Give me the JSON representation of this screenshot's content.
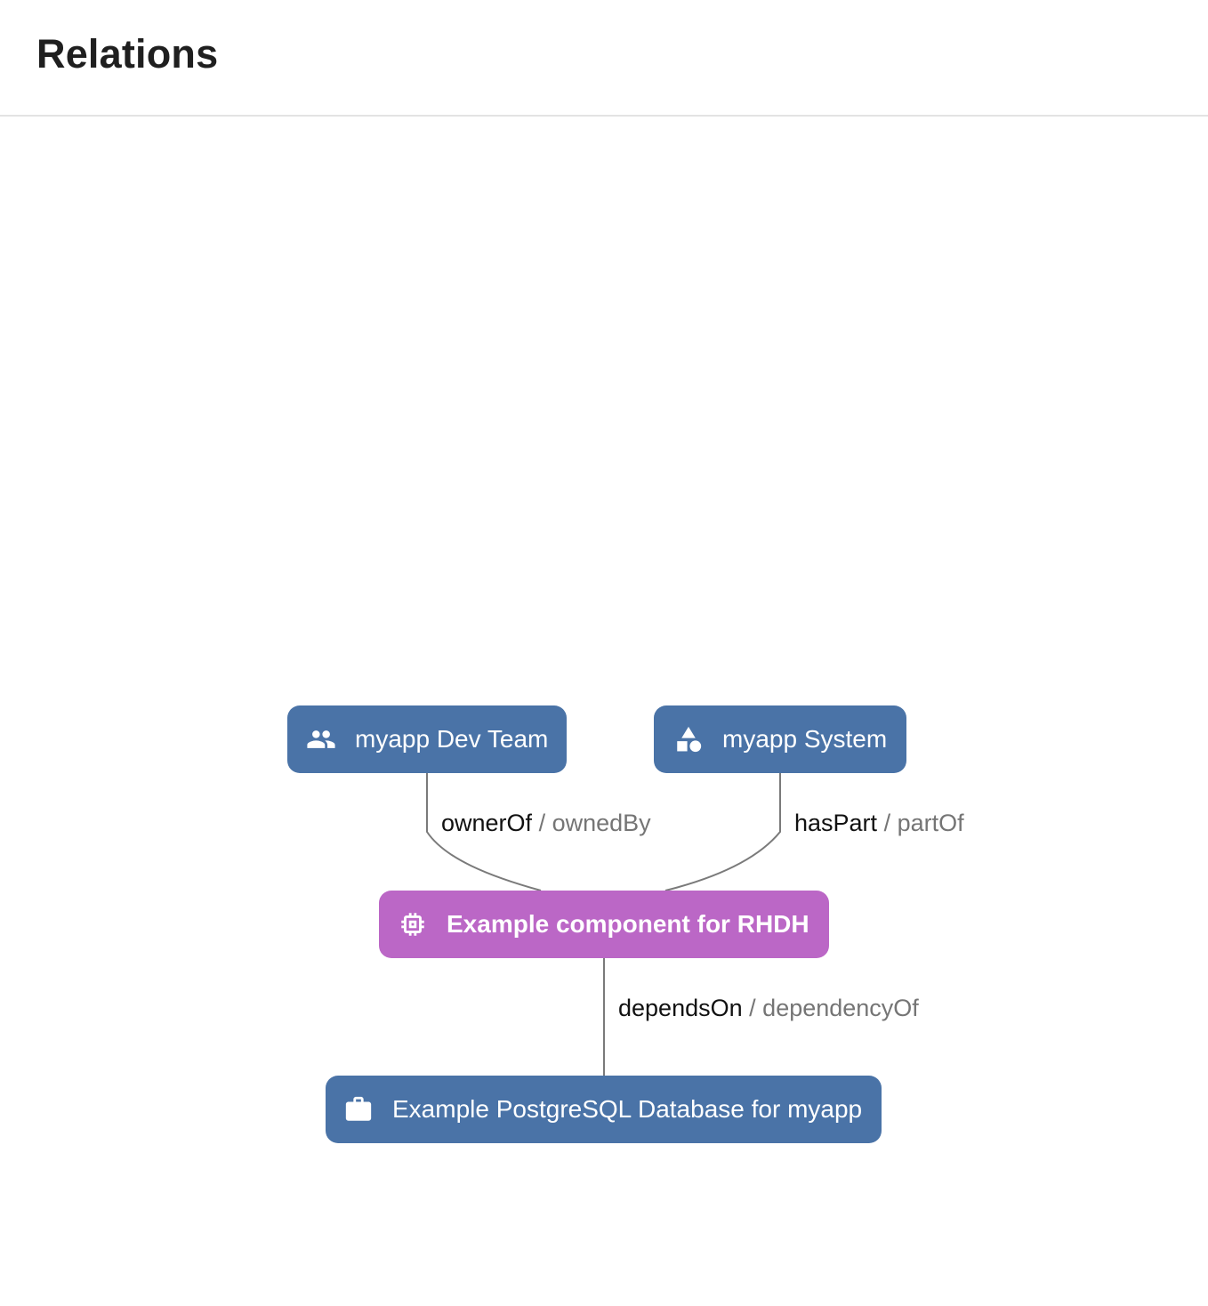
{
  "header": {
    "title": "Relations"
  },
  "graph": {
    "nodes": {
      "team": {
        "label": "myapp Dev Team",
        "icon": "group-icon",
        "color": "#4a73a7"
      },
      "system": {
        "label": "myapp System",
        "icon": "category-shapes-icon",
        "color": "#4a73a7"
      },
      "component": {
        "label": "Example component for RHDH",
        "icon": "memory-chip-icon",
        "color": "#bb67c6"
      },
      "database": {
        "label": "Example PostgreSQL Database for myapp",
        "icon": "briefcase-icon",
        "color": "#4a73a7"
      }
    },
    "edges": {
      "owner": {
        "primary": "ownerOf",
        "separator": "/",
        "secondary": "ownedBy"
      },
      "part": {
        "primary": "hasPart",
        "separator": "/",
        "secondary": "partOf"
      },
      "depends": {
        "primary": "dependsOn",
        "separator": "/",
        "secondary": "dependencyOf"
      }
    },
    "edge_color": "#7a7a7a"
  }
}
